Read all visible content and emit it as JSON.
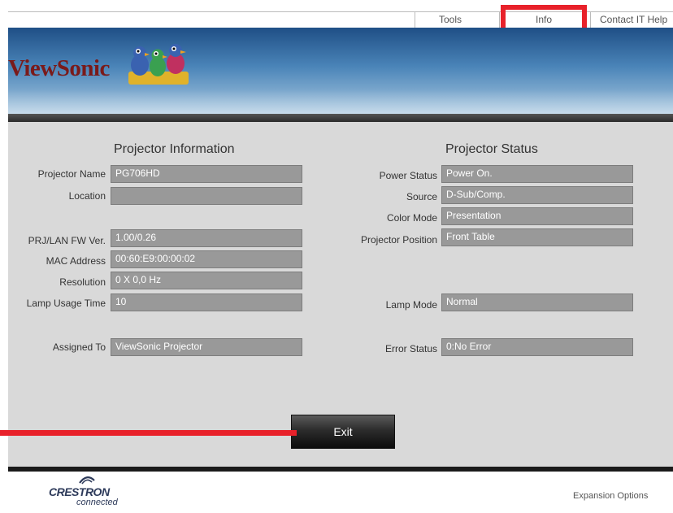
{
  "nav": {
    "items": [
      "Tools",
      "Info",
      "Contact IT Help"
    ]
  },
  "banner": {
    "logo_text": "ViewSonic"
  },
  "left": {
    "title": "Projector Information",
    "fields": [
      {
        "label": "Projector Name",
        "value": "PG706HD"
      },
      {
        "label": "Location",
        "value": ""
      },
      {
        "label": "PRJ/LAN FW Ver.",
        "value": "1.00/0.26"
      },
      {
        "label": "MAC Address",
        "value": "00:60:E9:00:00:02"
      },
      {
        "label": "Resolution",
        "value": "0 X 0,0 Hz"
      },
      {
        "label": "Lamp Usage Time",
        "value": "10"
      },
      {
        "label": "Assigned To",
        "value": "ViewSonic Projector"
      }
    ]
  },
  "right": {
    "title": "Projector Status",
    "fields": [
      {
        "label": "Power Status",
        "value": "Power On."
      },
      {
        "label": "Source",
        "value": "D-Sub/Comp."
      },
      {
        "label": "Color Mode",
        "value": "Presentation"
      },
      {
        "label": "Projector Position",
        "value": "Front Table"
      },
      {
        "label": "Lamp Mode",
        "value": "Normal"
      },
      {
        "label": "Error Status",
        "value": "0:No Error"
      }
    ]
  },
  "exit_label": "Exit",
  "footer": {
    "crestron_name": "CRESTRON",
    "crestron_sub": "connected",
    "expansion": "Expansion Options"
  },
  "colors": {
    "highlight": "#e8212a",
    "field_bg": "#999999",
    "panel_bg": "#d9d9d9",
    "logo": "#7a1a1a"
  }
}
